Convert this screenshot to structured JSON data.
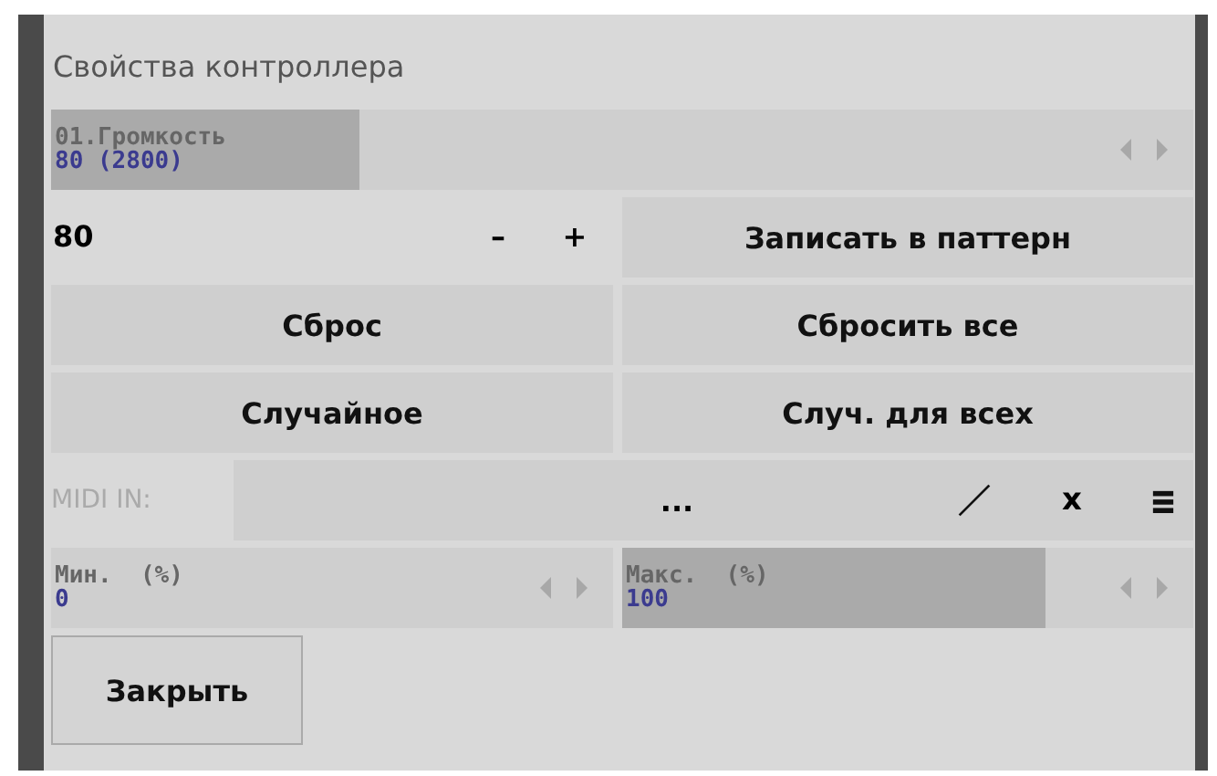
{
  "title": "Свойства контроллера",
  "param": {
    "name": "01.Громкость",
    "value": "80 (2800)",
    "level": 0.27
  },
  "value_field": {
    "value": "80",
    "minus": "–",
    "plus": "+"
  },
  "buttons": [
    {
      "label": "Записать в паттерн"
    },
    {
      "label": "Сброс"
    },
    {
      "label": "Сбросить все"
    },
    {
      "label": "Случайное"
    },
    {
      "label": "Случ. для всех"
    }
  ],
  "midi": {
    "label": "MIDI IN:",
    "disabled": true,
    "value": "...",
    "clear": "x"
  },
  "range": [
    {
      "name": "Мин.  (%)",
      "value": "0"
    },
    {
      "name": "Макс.  (%)",
      "value": "100",
      "level": 0.74
    }
  ],
  "close": "Закрыть"
}
